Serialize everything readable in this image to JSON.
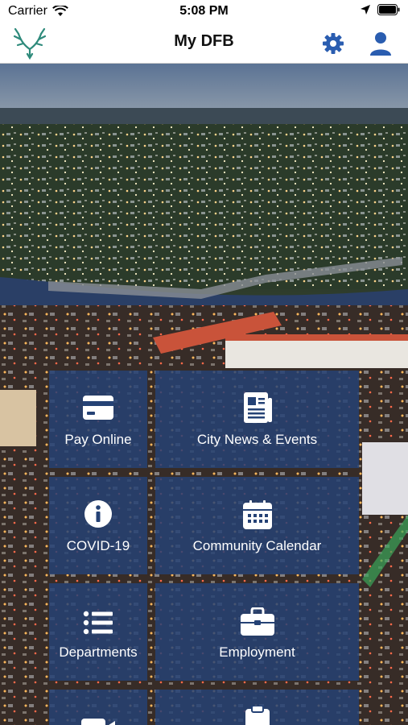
{
  "status": {
    "carrier": "Carrier",
    "time": "5:08 PM"
  },
  "nav": {
    "title": "My DFB"
  },
  "tiles": [
    {
      "label": "Pay Online",
      "icon": "credit-card-icon"
    },
    {
      "label": "City News & Events",
      "icon": "newspaper-icon"
    },
    {
      "label": "COVID-19",
      "icon": "info-icon"
    },
    {
      "label": "Community Calendar",
      "icon": "calendar-icon"
    },
    {
      "label": "Departments",
      "icon": "list-icon"
    },
    {
      "label": "Employment",
      "icon": "briefcase-icon"
    },
    {
      "label": "",
      "icon": "video-icon"
    },
    {
      "label": "",
      "icon": "clipboard-icon"
    }
  ],
  "colors": {
    "accent": "#2a5db0",
    "tile": "#254275"
  }
}
